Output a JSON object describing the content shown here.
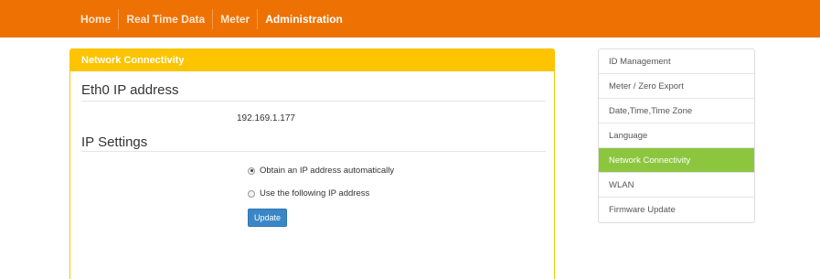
{
  "nav": {
    "items": [
      {
        "label": "Home"
      },
      {
        "label": "Real Time Data"
      },
      {
        "label": "Meter"
      },
      {
        "label": "Administration"
      }
    ],
    "active": "Administration"
  },
  "panel": {
    "heading": "Network Connectivity",
    "eth0_title": "Eth0 IP address",
    "ip_address": "192.169.1.177",
    "ip_settings_title": "IP Settings",
    "options": [
      {
        "label": "Obtain an IP address automatically",
        "selected": true
      },
      {
        "label": "Use the following IP address",
        "selected": false
      }
    ],
    "update_label": "Update"
  },
  "sidebar": {
    "items": [
      {
        "label": "ID Management"
      },
      {
        "label": "Meter / Zero Export"
      },
      {
        "label": "Date,Time,Time Zone"
      },
      {
        "label": "Language"
      },
      {
        "label": "Network Connectivity"
      },
      {
        "label": "WLAN"
      },
      {
        "label": "Firmware Update"
      }
    ],
    "active": "Network Connectivity"
  },
  "colors": {
    "topbar": "#ee7203",
    "panel_heading": "#fec400",
    "sidebar_active": "#8cc63f",
    "button": "#3a87c8"
  }
}
